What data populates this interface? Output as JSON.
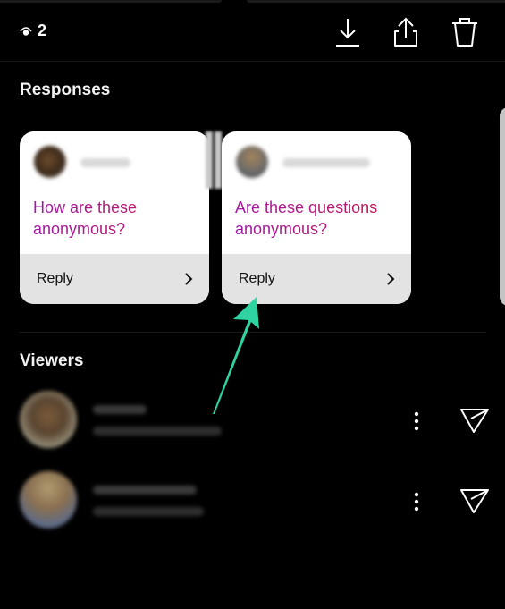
{
  "header": {
    "seen_icon": "eye-icon",
    "seen_count": "2",
    "actions": [
      {
        "name": "download",
        "icon": "download-icon"
      },
      {
        "name": "share",
        "icon": "share-icon"
      },
      {
        "name": "delete",
        "icon": "trash-icon"
      }
    ]
  },
  "responses": {
    "title": "Responses",
    "cards": [
      {
        "question": "How are these anonymous?",
        "reply_label": "Reply",
        "chevron_icon": "chevron-right-icon"
      },
      {
        "question": "Are these questions anonymous?",
        "reply_label": "Reply",
        "chevron_icon": "chevron-right-icon"
      }
    ]
  },
  "viewers": {
    "title": "Viewers",
    "items": [
      {
        "more_icon": "more-vertical-icon",
        "send_icon": "send-icon"
      },
      {
        "more_icon": "more-vertical-icon",
        "send_icon": "send-icon"
      }
    ]
  },
  "annotation": {
    "arrow_color": "#2ed3a1",
    "points_to": "Reply"
  },
  "colors": {
    "background": "#000000",
    "card_bg": "#ffffff",
    "reply_bar_bg": "#e3e3e3",
    "question_gradient": [
      "#a01aa6",
      "#c41447"
    ]
  }
}
